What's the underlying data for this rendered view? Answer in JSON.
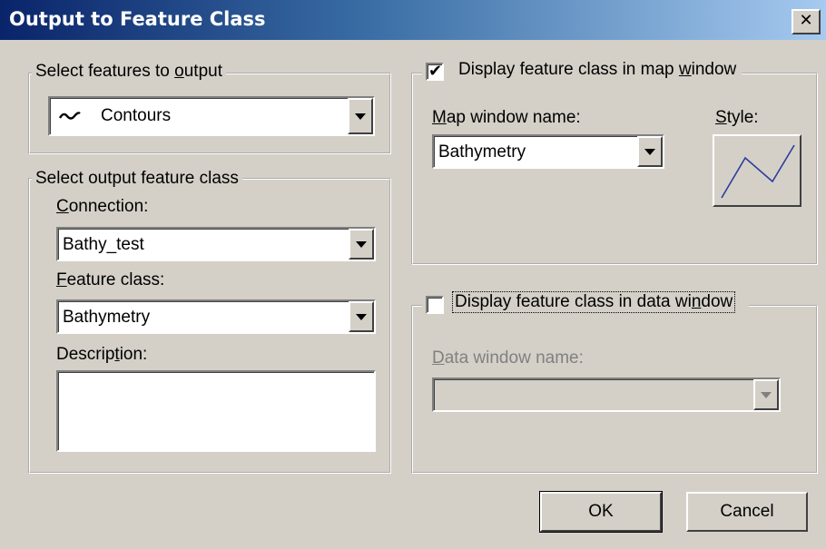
{
  "window": {
    "title": "Output to Feature Class",
    "close_glyph": "✕"
  },
  "select_features": {
    "legend_prefix": "Select features to ",
    "legend_accel": "o",
    "legend_suffix": "utput",
    "value": "Contours",
    "icon": "line-feature-icon"
  },
  "output_class": {
    "legend": "Select output feature class",
    "connection_accel": "C",
    "connection_rest": "onnection:",
    "connection_value": "Bathy_test",
    "feature_class_accel": "F",
    "feature_class_rest": "eature class:",
    "feature_class_value": "Bathymetry",
    "description_prefix": "Descrip",
    "description_accel": "t",
    "description_suffix": "ion:",
    "description_value": ""
  },
  "map_window": {
    "checked": true,
    "check_glyph": "✔",
    "legend_prefix": "Display feature class in map ",
    "legend_accel": "w",
    "legend_suffix": "indow",
    "name_accel": "M",
    "name_rest": "ap window name:",
    "name_value": "Bathymetry",
    "style_accel": "S",
    "style_rest": "tyle:",
    "style_icon": "line-style-preview-icon",
    "style_color": "#2a3e9c"
  },
  "data_window": {
    "checked": false,
    "legend_prefix": "Display feature class in data wi",
    "legend_accel": "n",
    "legend_suffix": "dow",
    "name_accel": "D",
    "name_rest": "ata window name:",
    "name_value": ""
  },
  "buttons": {
    "ok": "OK",
    "cancel": "Cancel"
  }
}
